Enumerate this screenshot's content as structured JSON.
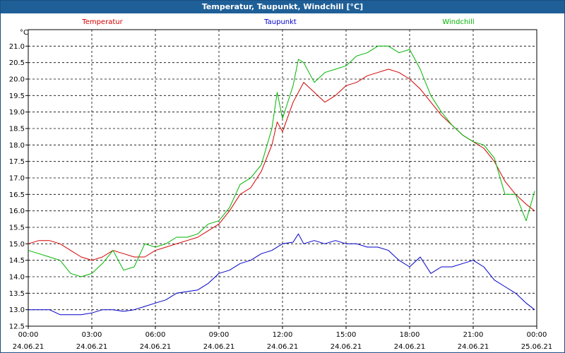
{
  "window": {
    "title": "Temperatur, Taupunkt, Windchill [°C]"
  },
  "chart_data": {
    "type": "line",
    "title": "Temperatur, Taupunkt, Windchill [°C]",
    "y_unit": "°C",
    "ylim": [
      12.5,
      21.5
    ],
    "y_ticks": [
      "12.5",
      "13.0",
      "13.5",
      "14.0",
      "14.5",
      "15.0",
      "15.5",
      "16.0",
      "16.5",
      "17.0",
      "17.5",
      "18.0",
      "18.5",
      "19.0",
      "19.5",
      "20.0",
      "20.5",
      "21.0"
    ],
    "x_ticks": [
      {
        "time": "00:00",
        "date": "24.06.21"
      },
      {
        "time": "03:00",
        "date": "24.06.21"
      },
      {
        "time": "06:00",
        "date": "24.06.21"
      },
      {
        "time": "09:00",
        "date": "24.06.21"
      },
      {
        "time": "12:00",
        "date": "24.06.21"
      },
      {
        "time": "15:00",
        "date": "24.06.21"
      },
      {
        "time": "18:00",
        "date": "24.06.21"
      },
      {
        "time": "21:00",
        "date": "24.06.21"
      },
      {
        "time": "00:00",
        "date": "25.06.21"
      }
    ],
    "xlim_hours": [
      0,
      24
    ],
    "grid": true,
    "colors": {
      "temperatur": "#d40000",
      "taupunkt": "#0000c8",
      "windchill": "#00b400"
    },
    "series": [
      {
        "name": "Temperatur",
        "color": "#d40000",
        "x": [
          0,
          0.5,
          1,
          1.5,
          2,
          2.5,
          3,
          3.5,
          4,
          4.5,
          5,
          5.5,
          6,
          6.5,
          7,
          7.5,
          8,
          8.5,
          9,
          9.5,
          10,
          10.5,
          11,
          11.5,
          11.75,
          12,
          12.5,
          12.75,
          13,
          13.5,
          14,
          14.5,
          15,
          15.5,
          16,
          16.5,
          17,
          17.5,
          18,
          18.5,
          19,
          19.5,
          20,
          20.5,
          21,
          21.5,
          22,
          22.5,
          23,
          23.5,
          23.9
        ],
        "values": [
          15.0,
          15.1,
          15.1,
          15.0,
          14.8,
          14.6,
          14.5,
          14.6,
          14.8,
          14.7,
          14.6,
          14.6,
          14.8,
          14.9,
          15.0,
          15.1,
          15.2,
          15.4,
          15.6,
          16.0,
          16.5,
          16.7,
          17.2,
          18.0,
          18.7,
          18.4,
          19.3,
          19.6,
          19.9,
          19.6,
          19.3,
          19.5,
          19.8,
          19.9,
          20.1,
          20.2,
          20.3,
          20.2,
          20.0,
          19.7,
          19.3,
          18.9,
          18.6,
          18.3,
          18.1,
          17.9,
          17.5,
          16.9,
          16.5,
          16.2,
          16.0
        ]
      },
      {
        "name": "Taupunkt",
        "color": "#0000c8",
        "x": [
          0,
          0.5,
          1,
          1.5,
          2,
          2.5,
          3,
          3.5,
          4,
          4.5,
          5,
          5.5,
          6,
          6.5,
          7,
          7.5,
          8,
          8.5,
          9,
          9.5,
          10,
          10.5,
          11,
          11.5,
          12,
          12.5,
          12.75,
          13,
          13.5,
          14,
          14.5,
          15,
          15.5,
          16,
          16.5,
          17,
          17.5,
          18,
          18.5,
          19,
          19.5,
          20,
          20.5,
          21,
          21.5,
          22,
          22.5,
          23,
          23.5,
          23.9
        ],
        "values": [
          13.0,
          13.0,
          13.0,
          12.85,
          12.85,
          12.85,
          12.9,
          13.0,
          13.0,
          12.95,
          13.0,
          13.1,
          13.2,
          13.3,
          13.5,
          13.55,
          13.6,
          13.8,
          14.1,
          14.2,
          14.4,
          14.5,
          14.7,
          14.8,
          15.0,
          15.05,
          15.3,
          15.0,
          15.1,
          15.0,
          15.1,
          15.0,
          15.0,
          14.9,
          14.9,
          14.8,
          14.5,
          14.3,
          14.6,
          14.1,
          14.3,
          14.3,
          14.4,
          14.5,
          14.3,
          13.9,
          13.7,
          13.5,
          13.2,
          13.0
        ]
      },
      {
        "name": "Windchill",
        "color": "#00b400",
        "x": [
          0,
          0.5,
          1,
          1.5,
          2,
          2.5,
          3,
          3.5,
          4,
          4.5,
          5,
          5.5,
          6,
          6.5,
          7,
          7.5,
          8,
          8.5,
          9,
          9.5,
          10,
          10.5,
          11,
          11.5,
          11.75,
          12,
          12.5,
          12.75,
          13,
          13.5,
          14,
          14.5,
          15,
          15.5,
          16,
          16.5,
          17,
          17.5,
          18,
          18.5,
          19,
          19.5,
          20,
          20.5,
          21,
          21.5,
          22,
          22.5,
          23,
          23.5,
          23.9
        ],
        "values": [
          14.8,
          14.7,
          14.6,
          14.5,
          14.1,
          14.0,
          14.1,
          14.4,
          14.8,
          14.2,
          14.3,
          15.0,
          14.9,
          15.0,
          15.2,
          15.2,
          15.3,
          15.6,
          15.7,
          16.1,
          16.8,
          17.0,
          17.4,
          18.5,
          19.6,
          18.8,
          19.8,
          20.6,
          20.5,
          19.9,
          20.2,
          20.3,
          20.4,
          20.7,
          20.8,
          21.0,
          21.0,
          20.8,
          20.9,
          20.3,
          19.5,
          19.0,
          18.6,
          18.3,
          18.1,
          18.0,
          17.6,
          16.5,
          16.5,
          15.7,
          16.6
        ]
      }
    ]
  }
}
